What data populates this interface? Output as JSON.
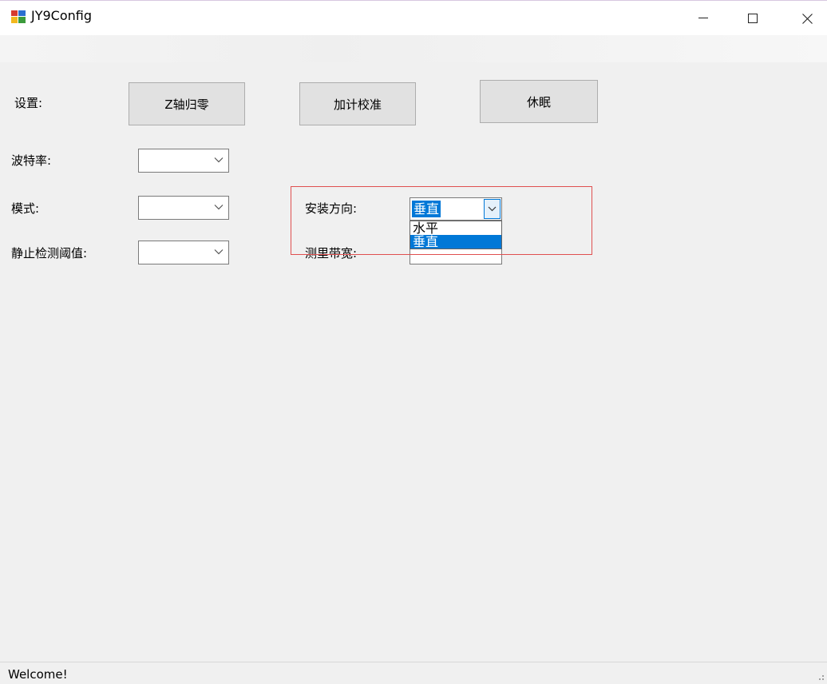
{
  "window": {
    "title": "JY9Config",
    "icon": "winforms-app-icon"
  },
  "settings": {
    "label": "设置:",
    "buttons": {
      "z_axis_zero": "Z轴归零",
      "accel_calibrate": "加计校准",
      "sleep": "休眠"
    }
  },
  "fields": {
    "baud_rate": {
      "label": "波特率:",
      "value": ""
    },
    "mode": {
      "label": "模式:",
      "value": ""
    },
    "static_threshold": {
      "label": "静止检测阈值:",
      "value": ""
    },
    "install_direction": {
      "label": "安装方向:",
      "value": "垂直",
      "options": [
        "水平",
        "垂直"
      ],
      "selected_option": "垂直"
    },
    "measure_bandwidth": {
      "label": "测里带宽:",
      "value": ""
    }
  },
  "status": {
    "text": "Welcome!"
  },
  "colors": {
    "accent": "#0078d7",
    "highlight_box": "#e05050",
    "background": "#f0f0f0"
  }
}
